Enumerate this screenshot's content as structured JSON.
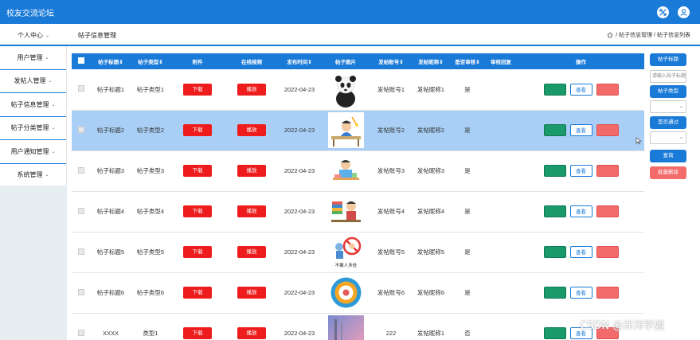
{
  "app": {
    "title": "校友交流论坛"
  },
  "header": {
    "personal_center": "个人中心",
    "page_title": "帖子信息管理",
    "breadcrumb": "/ 帖子信息管理 / 帖子信息列表"
  },
  "sidebar": {
    "items": [
      {
        "label": "用户管理"
      },
      {
        "label": "发帖人管理"
      },
      {
        "label": "帖子信息管理"
      },
      {
        "label": "帖子分类管理"
      },
      {
        "label": "用户通知管理"
      },
      {
        "label": "系统管理"
      }
    ]
  },
  "table": {
    "headers": [
      "帖子标题",
      "帖子类型",
      "附件",
      "在线视频",
      "发布时间",
      "帖子图片",
      "发帖账号",
      "发帖昵称",
      "是否审核",
      "审核回复",
      "操作"
    ],
    "download_label": "下载",
    "play_label": "播放",
    "edit_label": "修改",
    "view_label": "查看",
    "delete_label": "删除",
    "rows": [
      {
        "title": "帖子标题1",
        "type": "帖子类型1",
        "date": "2022-04-23",
        "account": "发帖账号1",
        "nickname": "发帖昵称1",
        "audited": "是",
        "reply": "",
        "image": "panda"
      },
      {
        "title": "帖子标题2",
        "type": "帖子类型2",
        "date": "2022-04-23",
        "account": "发帖账号2",
        "nickname": "发帖昵称2",
        "audited": "是",
        "reply": "",
        "image": "desk"
      },
      {
        "title": "帖子标题3",
        "type": "帖子类型3",
        "date": "2022-04-23",
        "account": "发帖账号3",
        "nickname": "发帖昵称3",
        "audited": "是",
        "reply": "",
        "image": "study"
      },
      {
        "title": "帖子标题4",
        "type": "帖子类型4",
        "date": "2022-04-23",
        "account": "发帖账号4",
        "nickname": "发帖昵称4",
        "audited": "是",
        "reply": "",
        "image": "books"
      },
      {
        "title": "帖子标题5",
        "type": "帖子类型5",
        "date": "2022-04-23",
        "account": "发帖账号5",
        "nickname": "发帖昵称5",
        "audited": "是",
        "reply": "",
        "image": "nocrowd"
      },
      {
        "title": "帖子标题6",
        "type": "帖子类型6",
        "date": "2022-04-23",
        "account": "发帖账号6",
        "nickname": "发帖昵称6",
        "audited": "是",
        "reply": "",
        "image": "circle"
      },
      {
        "title": "XXXX",
        "type": "类型1",
        "date": "2022-04-23",
        "account": "222",
        "nickname": "发帖昵称1",
        "audited": "否",
        "reply": "",
        "image": "pink"
      }
    ]
  },
  "image_caption": "不聚人多处",
  "right_panel": {
    "title_label": "帖子标题",
    "title_placeholder": "请输入帖子标题",
    "type_label": "帖子类型",
    "audit_label": "是否通过",
    "search_label": "查询",
    "batch_delete_label": "批量删除"
  },
  "watermark": "CSDN @洋洋学姐",
  "colors": {
    "primary": "#1a7ad8",
    "danger": "#ee1c1c",
    "selected_row": "#a9cff6"
  }
}
